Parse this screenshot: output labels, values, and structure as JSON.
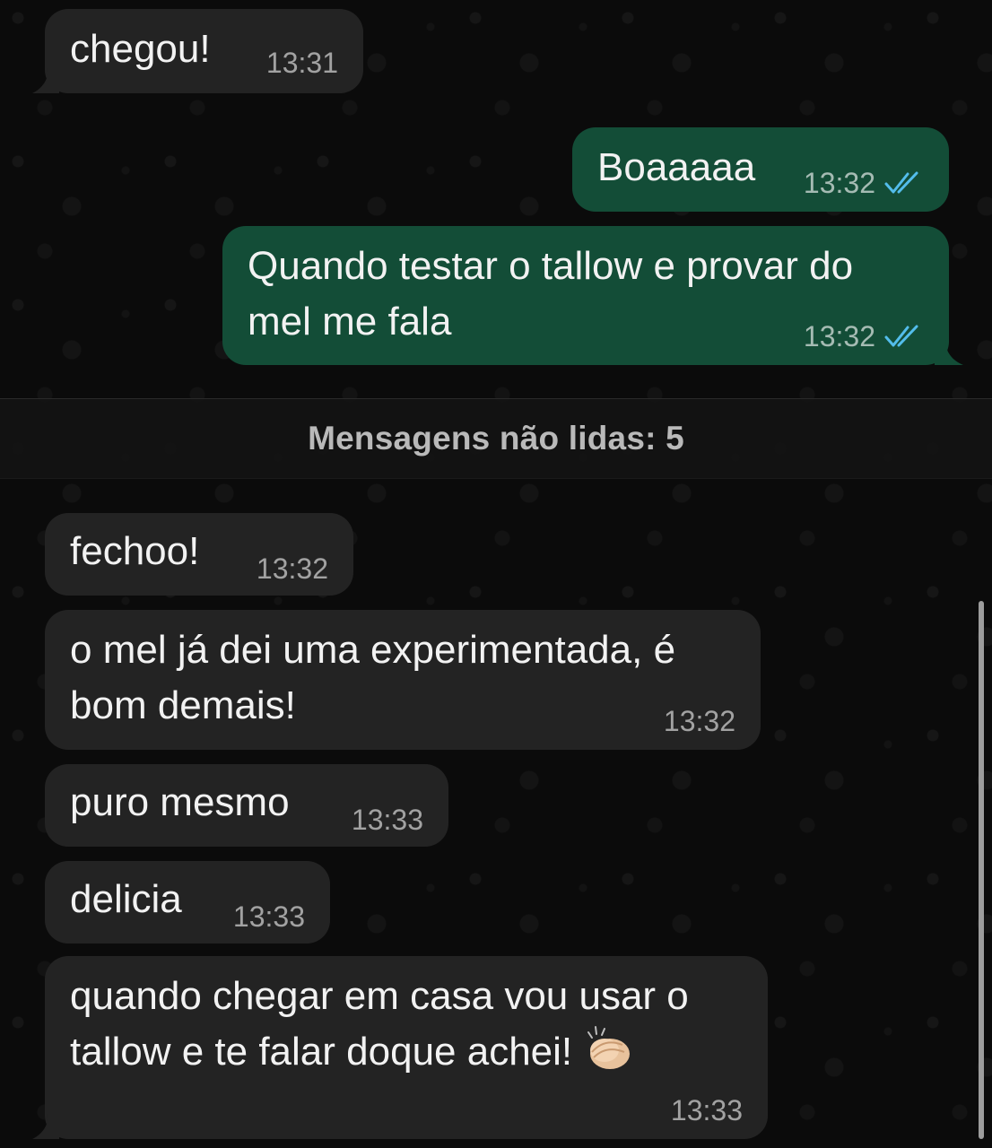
{
  "messages": [
    {
      "direction": "in",
      "text": "chegou!",
      "time": "13:31"
    },
    {
      "direction": "out",
      "text": "Boaaaaa",
      "time": "13:32",
      "status_icon": "double-check-read-icon"
    },
    {
      "direction": "out",
      "text": "Quando testar o tallow e provar do\nmel me fala",
      "time": "13:32",
      "status_icon": "double-check-read-icon"
    },
    {
      "direction": "in",
      "text": "fechoo!",
      "time": "13:32"
    },
    {
      "direction": "in",
      "text": "o mel já dei uma experimentada, é\nbom demais!",
      "time": "13:32"
    },
    {
      "direction": "in",
      "text": "puro mesmo",
      "time": "13:33"
    },
    {
      "direction": "in",
      "text": "delicia",
      "time": "13:33"
    },
    {
      "direction": "in",
      "text": "quando chegar em casa vou usar o\ntallow e te falar doque achei!",
      "time": "13:33",
      "emoji_icon": "clapping-hands-icon"
    }
  ],
  "unread_divider": {
    "label": "Mensagens não lidas: 5"
  },
  "colors": {
    "background": "#0b0b0b",
    "incoming_bubble": "#232323",
    "outgoing_bubble": "#134d37",
    "read_check": "#53bdeb"
  }
}
